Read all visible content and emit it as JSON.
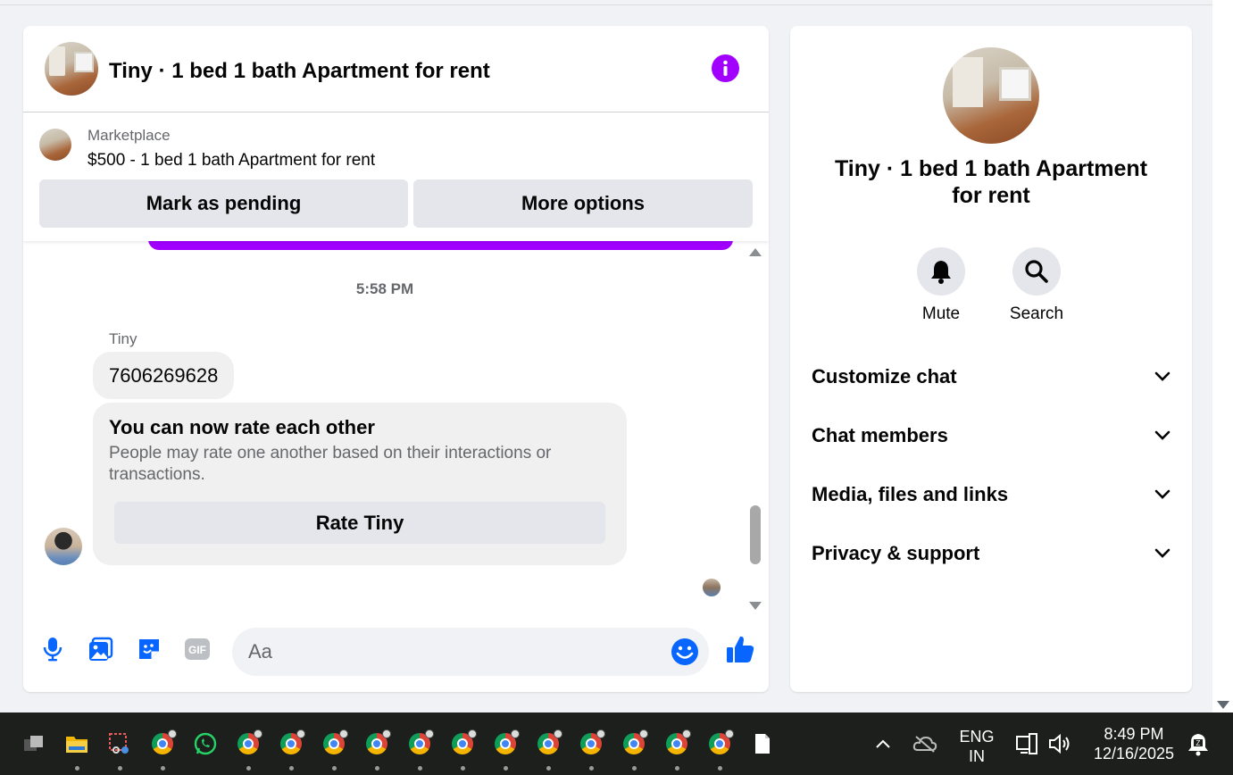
{
  "header": {
    "title": "Tiny · 1 bed 1 bath Apartment for rent",
    "accent_color": "#a100ff"
  },
  "marketplace": {
    "label": "Marketplace",
    "listing": "$500 - 1 bed 1 bath Apartment for rent",
    "mark_pending_label": "Mark as pending",
    "more_options_label": "More options"
  },
  "thread": {
    "timestamp": "5:58 PM",
    "sender": "Tiny",
    "phone_message": "7606269628",
    "rate_card": {
      "title": "You can now rate each other",
      "description": "People may rate one another based on their interactions or transactions.",
      "button_label": "Rate Tiny"
    }
  },
  "composer": {
    "placeholder": "Aa",
    "icons": [
      "microphone-icon",
      "photo-icon",
      "sticker-icon",
      "gif-icon",
      "emoji-icon",
      "thumbs-up-icon"
    ]
  },
  "details": {
    "title": "Tiny · 1 bed 1 bath Apartment for rent",
    "actions": [
      {
        "label": "Mute",
        "icon": "bell-icon"
      },
      {
        "label": "Search",
        "icon": "search-icon"
      }
    ],
    "sections": [
      {
        "label": "Customize chat"
      },
      {
        "label": "Chat members"
      },
      {
        "label": "Media, files and links"
      },
      {
        "label": "Privacy & support"
      }
    ]
  },
  "taskbar": {
    "language": "ENG",
    "region": "IN",
    "time": "8:49 PM",
    "date": "12/16/2025"
  }
}
